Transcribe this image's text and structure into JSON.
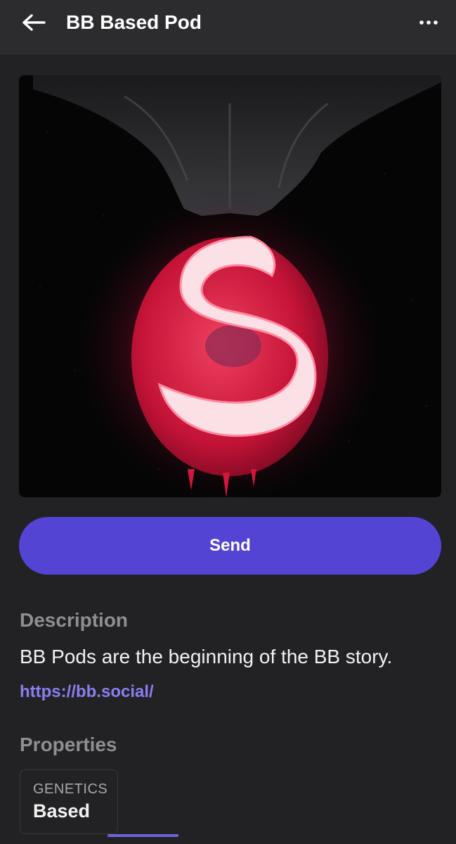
{
  "header": {
    "title": "BB Based Pod",
    "back_icon": "arrow-left-icon",
    "more_icon": "more-horizontal-icon"
  },
  "artwork": {
    "subject": "glowing red pod with white flame S emblem"
  },
  "actions": {
    "send_label": "Send"
  },
  "description": {
    "heading": "Description",
    "text": "BB Pods are the beginning of the BB story.",
    "link": "https://bb.social/"
  },
  "properties": {
    "heading": "Properties",
    "items": [
      {
        "key": "GENETICS",
        "value": "Based"
      }
    ]
  },
  "colors": {
    "background": "#222224",
    "header": "#2c2c2f",
    "accent": "#5444d4",
    "link": "#8b7ef0"
  }
}
